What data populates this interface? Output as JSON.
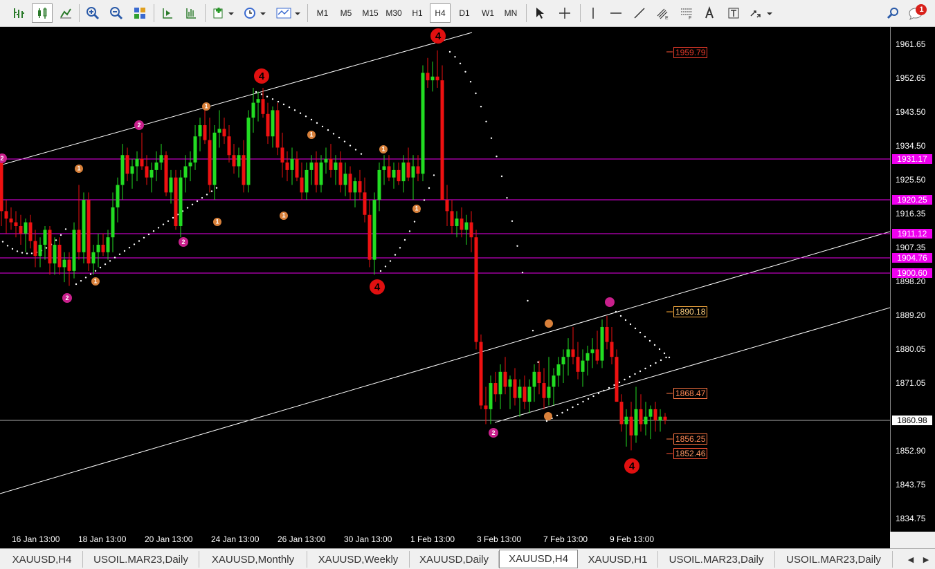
{
  "toolbar": {
    "timeframes": [
      "M1",
      "M5",
      "M15",
      "M30",
      "H1",
      "H4",
      "D1",
      "W1",
      "MN"
    ],
    "active_timeframe": "H4",
    "notification_count": "1"
  },
  "chart": {
    "colors": {
      "bull": "#22dd22",
      "bear": "#ee1111",
      "level_line": "#ee00ee",
      "grid": "#000000"
    },
    "price_ticks": [
      "1961.65",
      "1952.65",
      "1943.50",
      "1934.50",
      "1925.50",
      "1916.35",
      "1907.35",
      "1898.20",
      "1889.20",
      "1880.05",
      "1871.05",
      "1852.90",
      "1843.75",
      "1834.75"
    ],
    "current_price": "1860.98",
    "level_labels": [
      "1931.17",
      "1920.25",
      "1911.12",
      "1904.76",
      "1900.60"
    ],
    "orange_labels": [
      "1959.79",
      "1890.18",
      "1868.47",
      "1856.25",
      "1852.46"
    ],
    "time_labels": [
      "16 Jan 13:00",
      "18 Jan 13:00",
      "20 Jan 13:00",
      "24 Jan 13:00",
      "26 Jan 13:00",
      "30 Jan 13:00",
      "1 Feb 13:00",
      "3 Feb 13:00",
      "7 Feb 13:00",
      "9 Feb 13:00"
    ],
    "wave_markers": [
      "4",
      "4",
      "4",
      "4",
      "2",
      "2",
      "2",
      "2",
      "2",
      "1",
      "1",
      "1",
      "1",
      "1",
      "1",
      "1",
      "1"
    ]
  },
  "tabs": {
    "items": [
      "XAUUSD,H4",
      "USOIL.MAR23,Daily",
      "XAUUSD,Monthly",
      "XAUUSD,Weekly",
      "XAUUSD,Daily",
      "XAUUSD,H4",
      "XAUUSD,H1",
      "USOIL.MAR23,Daily",
      "USOIL.MAR23,Daily"
    ],
    "active_index": 5
  }
}
